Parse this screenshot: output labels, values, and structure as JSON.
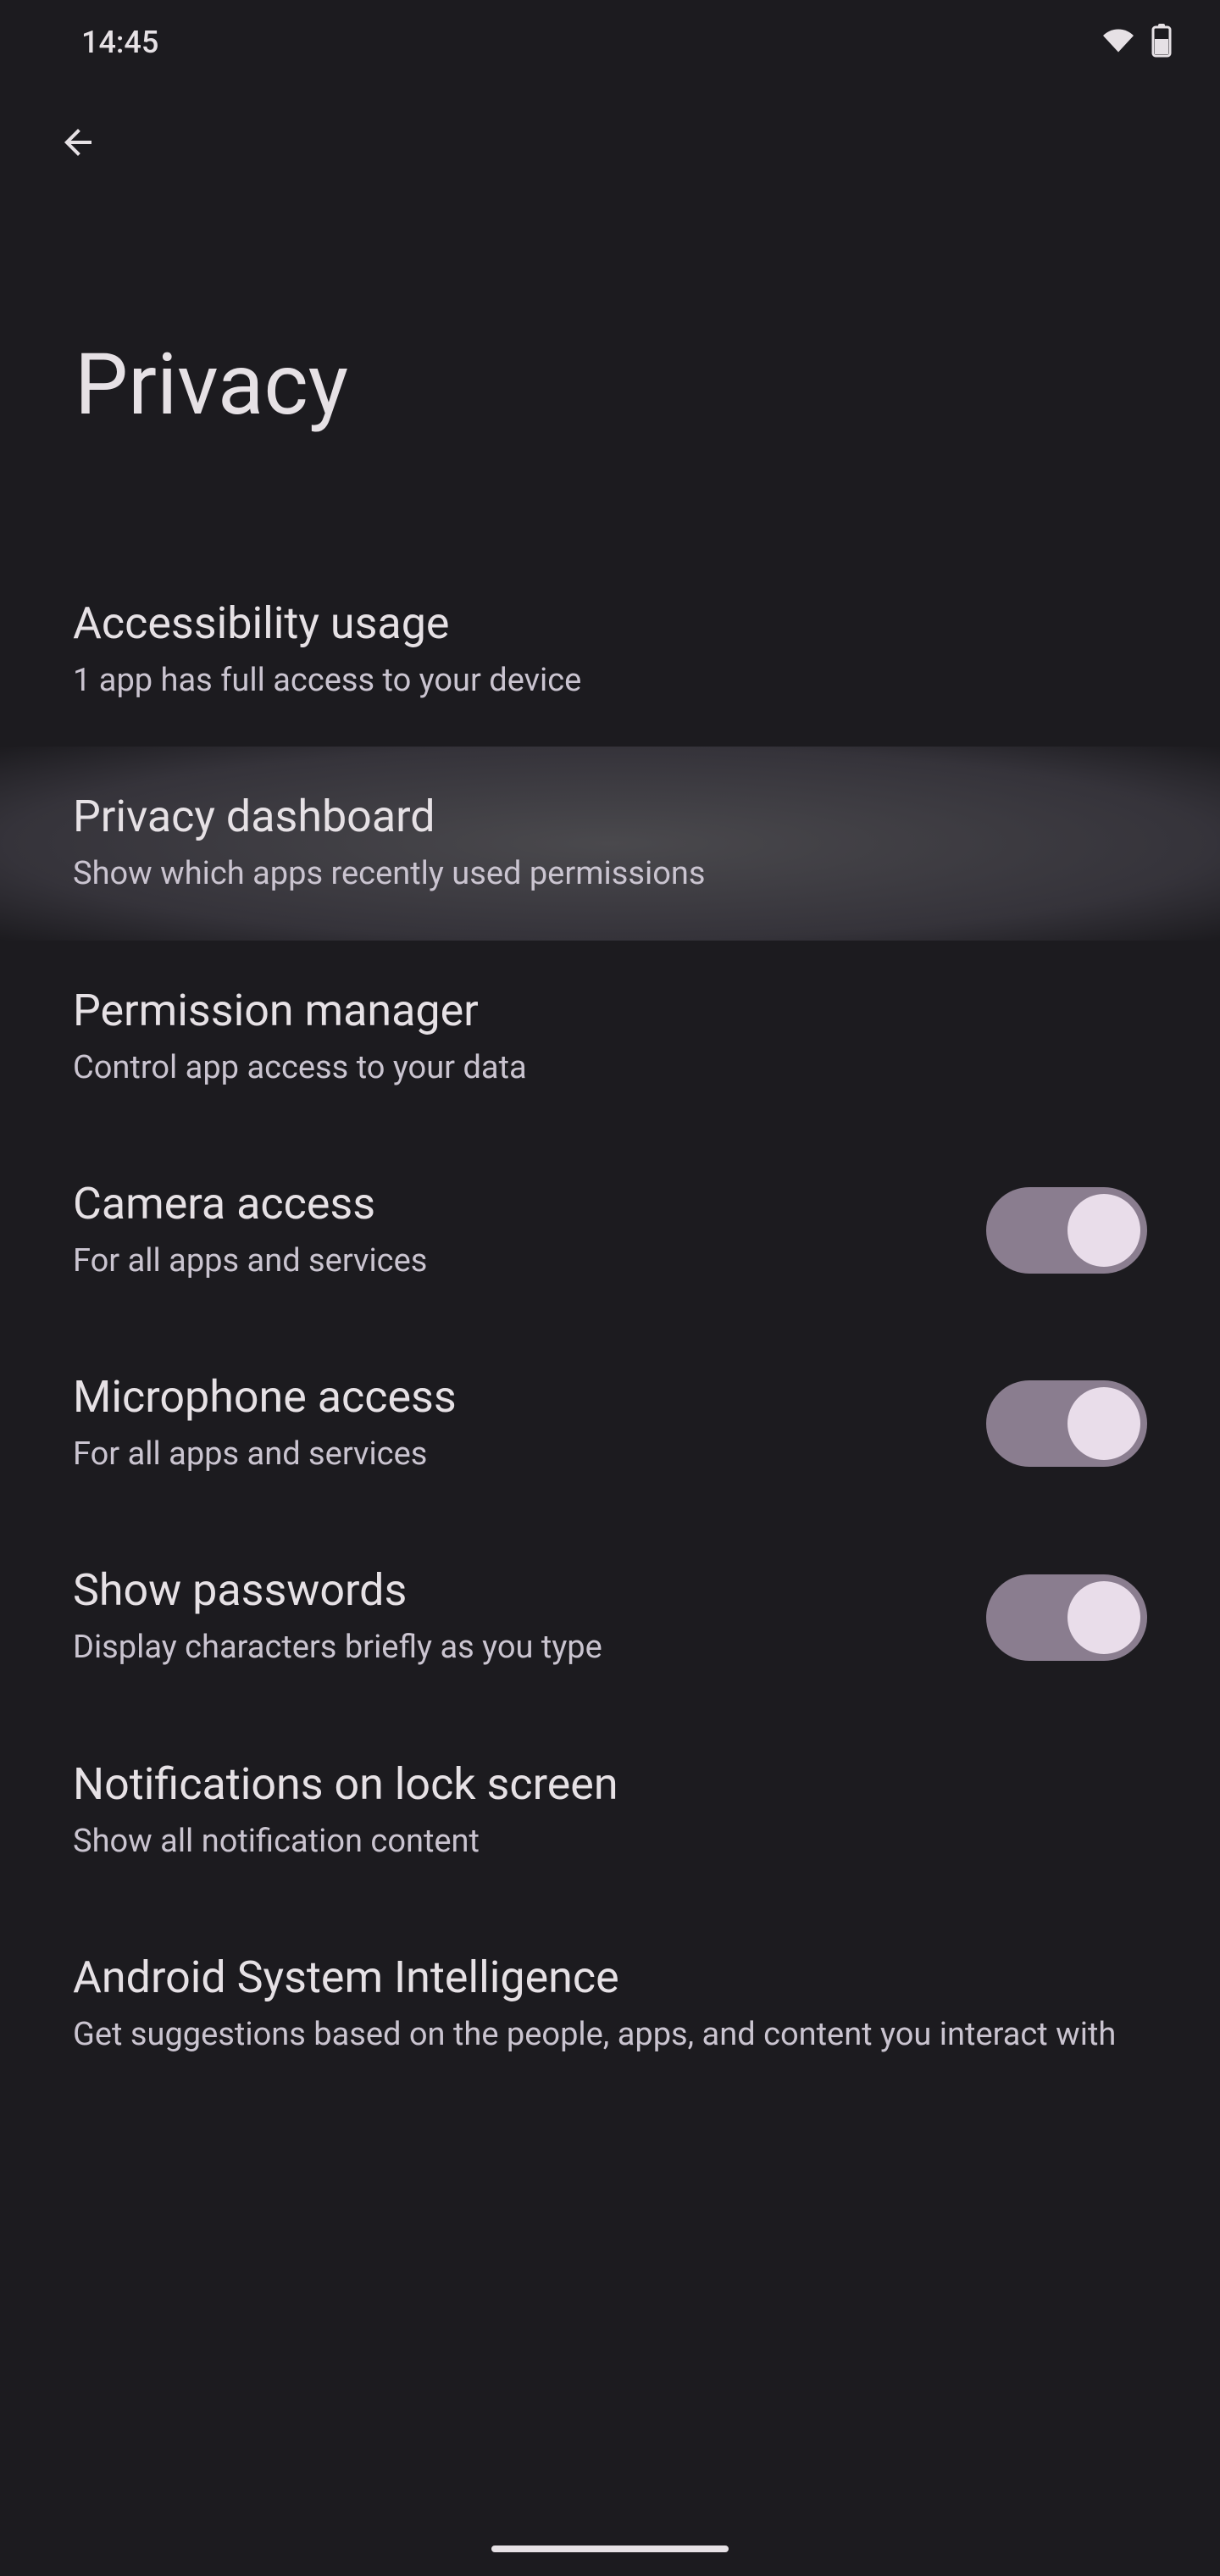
{
  "status": {
    "time": "14:45"
  },
  "header": {
    "title": "Privacy"
  },
  "settings": {
    "accessibility_usage": {
      "title": "Accessibility usage",
      "subtitle": "1 app has full access to your device"
    },
    "privacy_dashboard": {
      "title": "Privacy dashboard",
      "subtitle": "Show which apps recently used permissions"
    },
    "permission_manager": {
      "title": "Permission manager",
      "subtitle": "Control app access to your data"
    },
    "camera_access": {
      "title": "Camera access",
      "subtitle": "For all apps and services",
      "toggle": true
    },
    "microphone_access": {
      "title": "Microphone access",
      "subtitle": "For all apps and services",
      "toggle": true
    },
    "show_passwords": {
      "title": "Show passwords",
      "subtitle": "Display characters briefly as you type",
      "toggle": true
    },
    "notifications_lock": {
      "title": "Notifications on lock screen",
      "subtitle": "Show all notification content"
    },
    "android_intelligence": {
      "title": "Android System Intelligence",
      "subtitle": "Get suggestions based on the people, apps, and content you interact with"
    }
  }
}
